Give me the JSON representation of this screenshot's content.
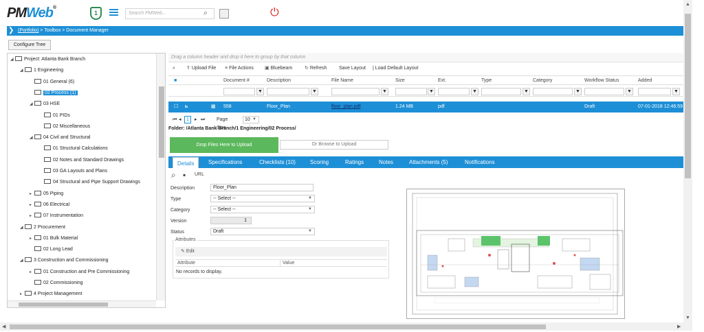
{
  "app": {
    "logo_pm": "PM",
    "logo_web": "Web",
    "logo_reg": "®",
    "notifications_count": "1"
  },
  "search": {
    "placeholder": "Search PMWeb..."
  },
  "breadcrumb": {
    "portfolio": "(Portfolio)",
    "rest": " > Toolbox > Document Manager"
  },
  "configure_tree": "Configure Tree",
  "tree": [
    {
      "label": "Project: Atlanta Bank Branch",
      "level": 0,
      "expanded": true
    },
    {
      "label": "1 Engineering",
      "level": 1,
      "expanded": true
    },
    {
      "label": "01 General (6)",
      "level": 2,
      "expanded": null
    },
    {
      "label": "02 Process (1)",
      "level": 2,
      "expanded": null,
      "selected": true
    },
    {
      "label": "03 HSE",
      "level": 2,
      "expanded": true
    },
    {
      "label": "01 PIDs",
      "level": 3,
      "expanded": null
    },
    {
      "label": "02 Miscellaneous",
      "level": 3,
      "expanded": null
    },
    {
      "label": "04 Civil and Structural",
      "level": 2,
      "expanded": true
    },
    {
      "label": "01 Structural Calculations",
      "level": 3,
      "expanded": null
    },
    {
      "label": "02 Notes and Standard Drawings",
      "level": 3,
      "expanded": null
    },
    {
      "label": "03 GA Layouts and Plans",
      "level": 3,
      "expanded": null
    },
    {
      "label": "04 Structural and Pipe Support Drawings",
      "level": 3,
      "expanded": null
    },
    {
      "label": "05 Piping",
      "level": 2,
      "expanded": false
    },
    {
      "label": "06 Electrical",
      "level": 2,
      "expanded": false
    },
    {
      "label": "07 Instrumentation",
      "level": 2,
      "expanded": false
    },
    {
      "label": "2 Procurement",
      "level": 1,
      "expanded": true
    },
    {
      "label": "01 Bulk Material",
      "level": 2,
      "expanded": false
    },
    {
      "label": "02 Long Lead",
      "level": 2,
      "expanded": null
    },
    {
      "label": "3 Construction and Commissioning",
      "level": 1,
      "expanded": true
    },
    {
      "label": "01 Construction and Pre Commissioning",
      "level": 2,
      "expanded": false
    },
    {
      "label": "02 Commissioning",
      "level": 2,
      "expanded": null
    },
    {
      "label": "4 Project Management",
      "level": 1,
      "expanded": false
    }
  ],
  "grid": {
    "group_hint": "Drag a column header and drop it here to group by that column",
    "toolbar": {
      "upload": "Upload File",
      "actions": "File Actions",
      "bluebeam": "Bluebeam",
      "refresh": "Refresh",
      "save_layout": "Save Layout",
      "load_layout": "| Load Default Layout"
    },
    "columns": [
      "Document #",
      "Description",
      "File Name",
      "Size",
      "Ext.",
      "Type",
      "Category",
      "Workflow Status",
      "Added"
    ],
    "row": {
      "doc_no": "558",
      "description": "Floor_Plan",
      "file_name": "floor_plan.pdf",
      "size": "1.24 MB",
      "ext": "pdf",
      "type": "",
      "category": "",
      "workflow_status": "Draft",
      "added": "07-01-2018 12:46:59"
    },
    "pager": {
      "current": "1",
      "page_size_label": "Page Size",
      "page_size": "10"
    },
    "folder_path": "Folder: /Atlanta Bank Branch/1 Engineering/02 Process/"
  },
  "upload": {
    "drop": "Drop Files Here to Upload",
    "browse": "Or Browse to Upload"
  },
  "tabs": [
    "Details",
    "Specifications",
    "Checklists (10)",
    "Scoring",
    "Ratings",
    "Notes",
    "Attachments (5)",
    "Notifications"
  ],
  "details": {
    "url_label": "URL",
    "fields": {
      "description": {
        "label": "Description",
        "value": "Floor_Plan"
      },
      "type": {
        "label": "Type",
        "value": "-- Select --"
      },
      "category": {
        "label": "Category",
        "value": "-- Select --"
      },
      "version": {
        "label": "Version",
        "value": "1"
      },
      "status": {
        "label": "Status",
        "value": "Draft"
      }
    },
    "attributes": {
      "title": "Attributes",
      "edit": "Edit",
      "col_attribute": "Attribute",
      "col_value": "Value",
      "empty": "No records to display."
    }
  },
  "colors": {
    "accent": "#1d8fd6",
    "green": "#5cb85c",
    "power": "#e02020"
  }
}
